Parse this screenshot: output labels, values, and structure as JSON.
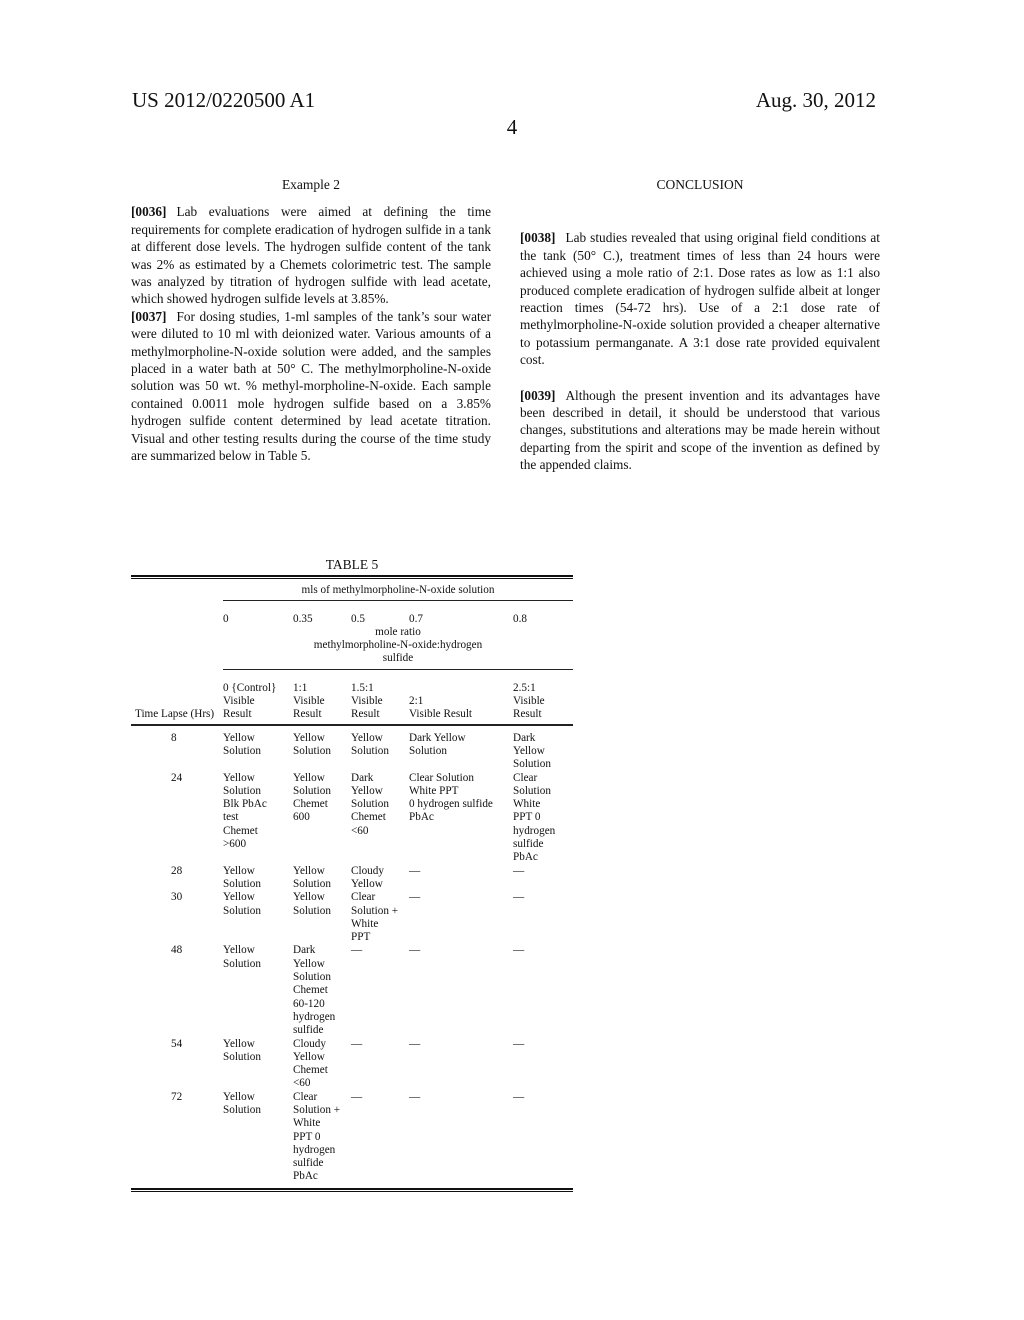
{
  "header": {
    "publication_number": "US 2012/0220500 A1",
    "date": "Aug. 30, 2012",
    "page_number": "4"
  },
  "left_column": {
    "heading": "Example 2",
    "paragraphs": [
      {
        "number": "[0036]",
        "text": "Lab evaluations were aimed at defining the time requirements for complete eradication of hydrogen sulfide in a tank at different dose levels. The hydrogen sulfide content of the tank was 2% as estimated by a Chemets colorimetric test. The sample was analyzed by titration of hydrogen sulfide with lead acetate, which showed hydrogen sulfide levels at 3.85%."
      },
      {
        "number": "[0037]",
        "text": "For dosing studies, 1-ml samples of the tank’s sour water were diluted to 10 ml with deionized water. Various amounts of a methylmorpholine-N-oxide solution were added, and the samples placed in a water bath at 50° C. The methylmorpholine-N-oxide solution was 50 wt. % methyl-morpholine-N-oxide. Each sample contained 0.0011 mole hydrogen sulfide based on a 3.85% hydrogen sulfide content determined by lead acetate titration. Visual and other testing results during the course of the time study are summarized below in Table 5."
      }
    ]
  },
  "right_column": {
    "heading": "CONCLUSION",
    "paragraphs": [
      {
        "number": "[0038]",
        "text": "Lab studies revealed that using original field conditions at the tank (50° C.), treatment times of less than 24 hours were achieved using a mole ratio of 2:1. Dose rates as low as 1:1 also produced complete eradication of hydrogen sulfide albeit at longer reaction times (54-72 hrs). Use of a 2:1 dose rate of methylmorpholine-N-oxide solution provided a cheaper alternative to potassium permanganate. A 3:1 dose rate provided equivalent cost."
      },
      {
        "number": "[0039]",
        "text": "Although the present invention and its advantages have been described in detail, it should be understood that various changes, substitutions and alterations may be made herein without departing from the spirit and scope of the invention as defined by the appended claims."
      }
    ]
  },
  "table": {
    "title": "TABLE 5",
    "group_header": "mls of methylmorpholine-N-oxide solution",
    "doses": [
      "0",
      "0.35",
      "0.5",
      "0.7",
      "0.8"
    ],
    "mole_ratio_label": [
      "mole ratio",
      "methylmorpholine-N-oxide:hydrogen",
      "sulfide"
    ],
    "columns": [
      [
        "Time Lapse (Hrs)"
      ],
      [
        "0 {Control}",
        "Visible",
        "Result"
      ],
      [
        "1:1",
        "Visible",
        "Result"
      ],
      [
        "1.5:1",
        "Visible",
        "Result"
      ],
      [
        "2:1",
        "Visible Result"
      ],
      [
        "2.5:1",
        "Visible",
        "Result"
      ]
    ],
    "rows": [
      {
        "time": "8",
        "cells": [
          [
            "Yellow",
            "Solution"
          ],
          [
            "Yellow",
            "Solution"
          ],
          [
            "Yellow",
            "Solution"
          ],
          [
            "Dark Yellow",
            "Solution"
          ],
          [
            "Dark",
            "Yellow",
            "Solution"
          ]
        ]
      },
      {
        "time": "24",
        "cells": [
          [
            "Yellow",
            "Solution",
            "Blk PbAc",
            "test",
            "Chemet",
            ">600"
          ],
          [
            "Yellow",
            "Solution",
            "Chemet",
            "600"
          ],
          [
            "Dark",
            "Yellow",
            "Solution",
            "Chemet",
            "<60"
          ],
          [
            "Clear Solution",
            "White PPT",
            "0 hydrogen sulfide",
            "PbAc"
          ],
          [
            "Clear",
            "Solution",
            "White",
            "PPT 0",
            "hydrogen",
            "sulfide",
            "PbAc"
          ]
        ]
      },
      {
        "time": "28",
        "cells": [
          [
            "Yellow",
            "Solution"
          ],
          [
            "Yellow",
            "Solution"
          ],
          [
            "Cloudy",
            "Yellow"
          ],
          [
            "—"
          ],
          [
            "—"
          ]
        ]
      },
      {
        "time": "30",
        "cells": [
          [
            "Yellow",
            "Solution"
          ],
          [
            "Yellow",
            "Solution"
          ],
          [
            "Clear",
            "Solution +",
            "White",
            "PPT"
          ],
          [
            "—"
          ],
          [
            "—"
          ]
        ]
      },
      {
        "time": "48",
        "cells": [
          [
            "Yellow",
            "Solution"
          ],
          [
            "Dark",
            "Yellow",
            "Solution",
            "Chemet",
            "60-120",
            "hydrogen",
            "sulfide"
          ],
          [
            "—"
          ],
          [
            "—"
          ],
          [
            "—"
          ]
        ]
      },
      {
        "time": "54",
        "cells": [
          [
            "Yellow",
            "Solution"
          ],
          [
            "Cloudy",
            "Yellow",
            "Chemet",
            "<60"
          ],
          [
            "—"
          ],
          [
            "—"
          ],
          [
            "—"
          ]
        ]
      },
      {
        "time": "72",
        "cells": [
          [
            "Yellow",
            "Solution"
          ],
          [
            "Clear",
            "Solution +",
            "White",
            "PPT 0",
            "hydrogen",
            "sulfide",
            "PbAc"
          ],
          [
            "—"
          ],
          [
            "—"
          ],
          [
            "—"
          ]
        ]
      }
    ]
  }
}
